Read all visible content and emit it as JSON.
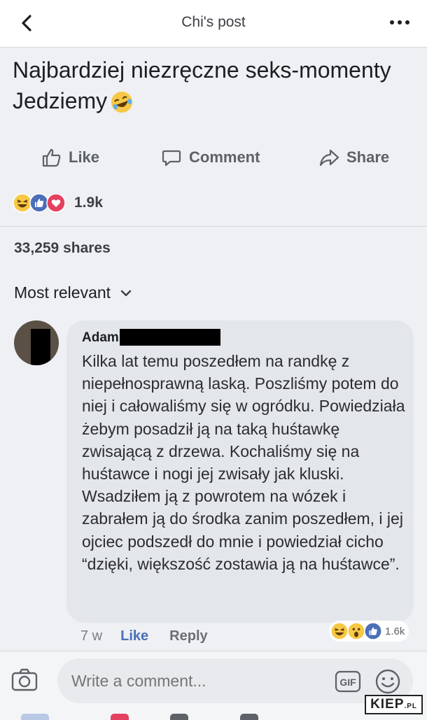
{
  "header": {
    "title": "Chi's post",
    "back_icon": "chevron-left-icon",
    "more_icon": "more-horizontal-icon"
  },
  "post": {
    "line1": "Najbardziej niezręczne seks-momenty",
    "line2": "Jedziemy",
    "emoji": "rofl-emoji"
  },
  "actions": {
    "like": "Like",
    "comment": "Comment",
    "share": "Share"
  },
  "reactions": {
    "icons": [
      "haha-reaction",
      "like-reaction",
      "love-reaction"
    ],
    "count": "1.9k"
  },
  "shares": "33,259 shares",
  "sort": {
    "label": "Most relevant"
  },
  "comment": {
    "author": "Adam",
    "text": "Kilka lat temu poszedłem na randkę z niepełnosprawną laską. Poszliśmy potem do niej i całowaliśmy się w ogródku. Powiedziała żebym posadził ją na taką huśtawkę zwisającą z drzewa. Kochaliśmy się na huśtawce i nogi jej zwisały jak kluski. Wsadziłem ją z powrotem na wózek i zabrałem ją do środka zanim poszedłem, i jej ojciec podszedł do mnie i powiedział cicho “dzięki, większość zostawia ją na huśtawce”.",
    "time": "7 w",
    "like": "Like",
    "reply": "Reply",
    "reaction_icons": [
      "haha-reaction",
      "wow-reaction",
      "like-reaction"
    ],
    "reaction_count": "1.6k"
  },
  "composer": {
    "placeholder": "Write a comment...",
    "gif_label": "GIF"
  },
  "watermark": {
    "main": "KIEP",
    "suffix": ".PL"
  },
  "colors": {
    "like_blue": "#4b6fb8",
    "love_red": "#e4405f",
    "haha_yellow": "#f7c845"
  }
}
